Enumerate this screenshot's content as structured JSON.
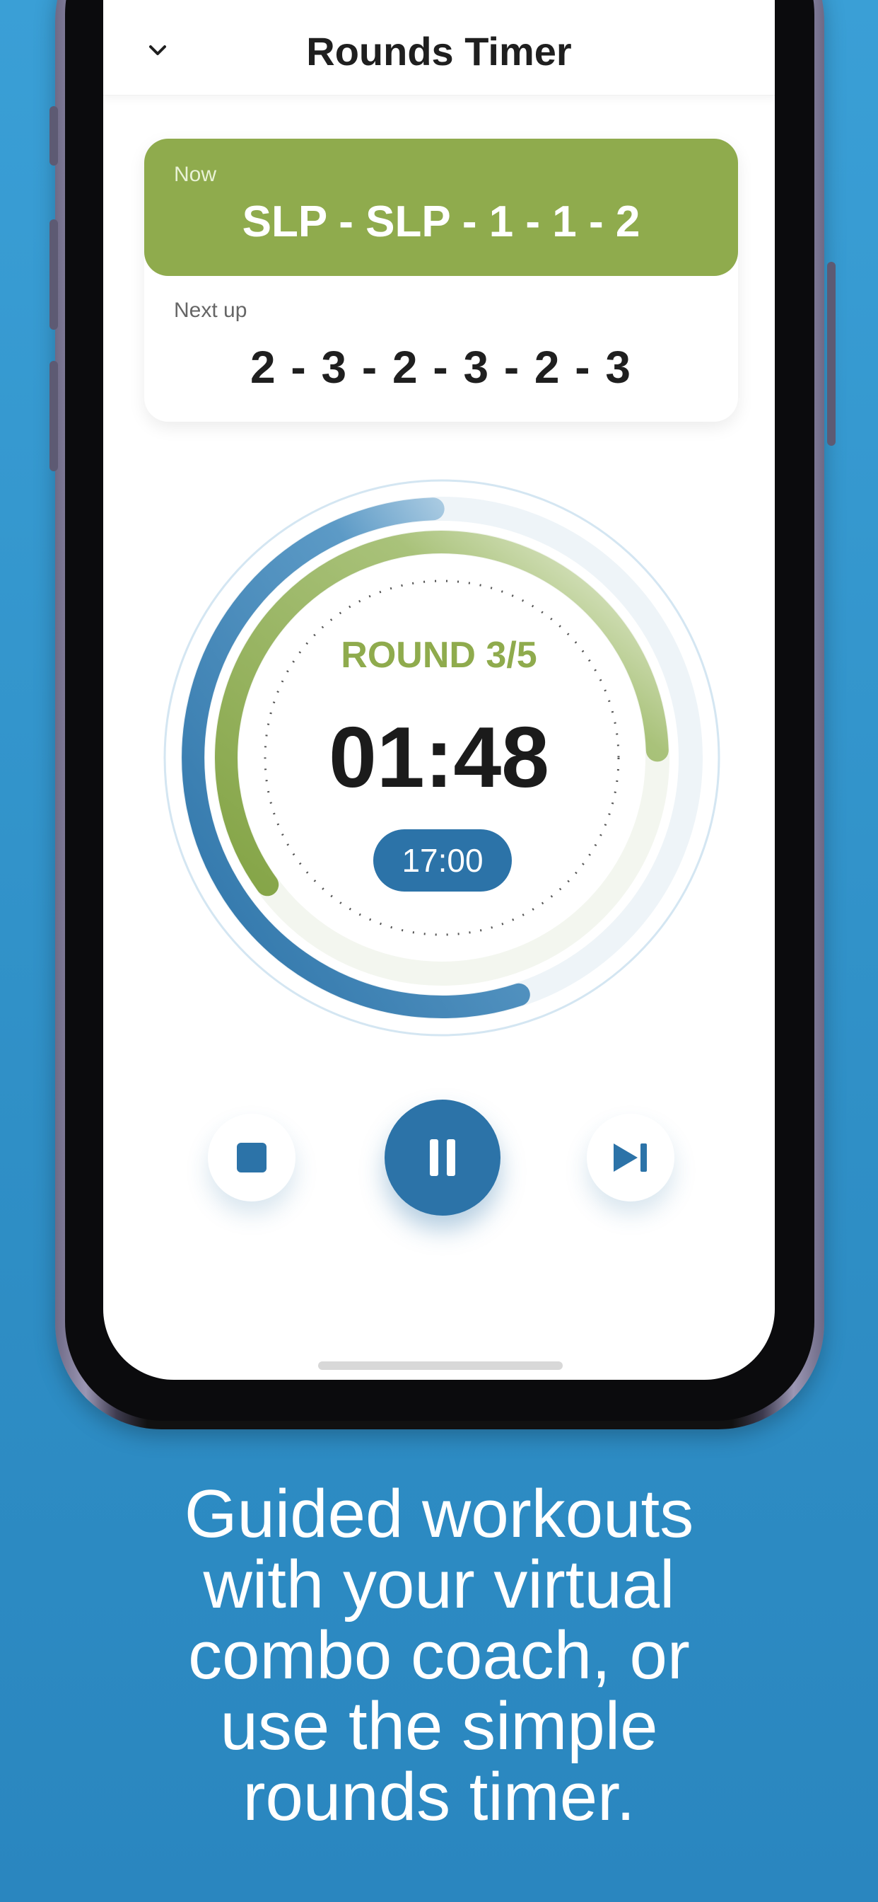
{
  "header": {
    "title": "Rounds Timer"
  },
  "current": {
    "label": "Now",
    "combo": "SLP - SLP - 1 - 1 - 2"
  },
  "next": {
    "label": "Next up",
    "combo": "2 - 3 - 2 - 3 - 2 - 3"
  },
  "timer": {
    "round_label": "ROUND 3/5",
    "time_remaining": "01:48",
    "total_time": "17:00",
    "round_progress": 0.6,
    "total_progress": 0.55
  },
  "colors": {
    "accent_green": "#8fab4d",
    "accent_blue": "#2c73a8",
    "background_blue": "#3a9fd6"
  },
  "controls": {
    "stop_icon": "stop-icon",
    "pause_icon": "pause-icon",
    "skip_icon": "skip-next-icon"
  },
  "caption": {
    "lines": [
      "Guided workouts",
      "with your virtual",
      "combo coach, or",
      "use the simple",
      "rounds timer."
    ]
  }
}
